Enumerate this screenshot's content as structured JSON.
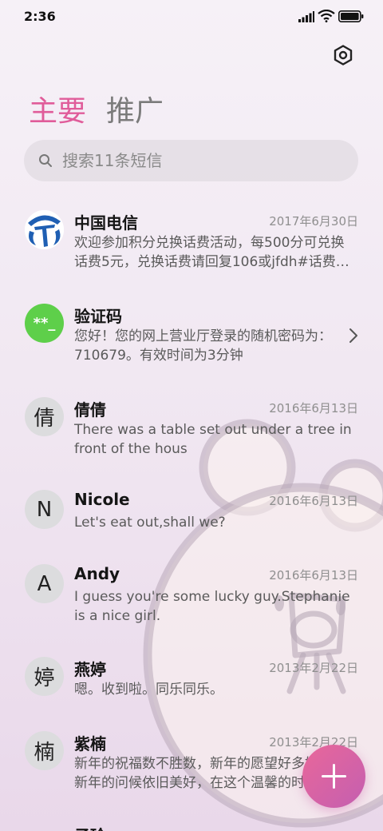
{
  "status_bar": {
    "time": "2:36"
  },
  "tabs": {
    "main": "主要",
    "promo": "推广"
  },
  "search": {
    "placeholder": "搜索11条短信"
  },
  "messages": [
    {
      "avatar": "",
      "sender": "中国电信",
      "date": "2017年6月30日",
      "preview": "欢迎参加积分兑换话费活动，每500分可兑换\n话费5元，兑换话费请回复106或jfdh#话费…"
    },
    {
      "avatar": "**_",
      "sender": "验证码",
      "date": "",
      "preview": "您好！您的网上营业厅登录的随机密码为：\n710679。有效时间为3分钟"
    },
    {
      "avatar": "倩",
      "sender": "倩倩",
      "date": "2016年6月13日",
      "preview": "There was a table set out under a tree in\nfront of the hous"
    },
    {
      "avatar": "N",
      "sender": "Nicole",
      "date": "2016年6月13日",
      "preview": "Let's eat out,shall we?"
    },
    {
      "avatar": "A",
      "sender": "Andy",
      "date": "2016年6月13日",
      "preview": "I guess you're some lucky guy.Stephanie\nis a nice girl."
    },
    {
      "avatar": "婷",
      "sender": "燕婷",
      "date": "2013年2月22日",
      "preview": "嗯。收到啦。同乐同乐。"
    },
    {
      "avatar": "楠",
      "sender": "紫楠",
      "date": "2013年2月22日",
      "preview": "新年的祝福数不胜数，新年的愿望好多好多\n新年的问候依旧美好，在这个温馨的时刻"
    },
    {
      "avatar": "",
      "sender": "子玲",
      "date": "",
      "preview": ""
    }
  ],
  "colors": {
    "accent": "#e05c9a",
    "verify_green": "#5ecf4a",
    "telecom_blue": "#1f5fb3"
  }
}
